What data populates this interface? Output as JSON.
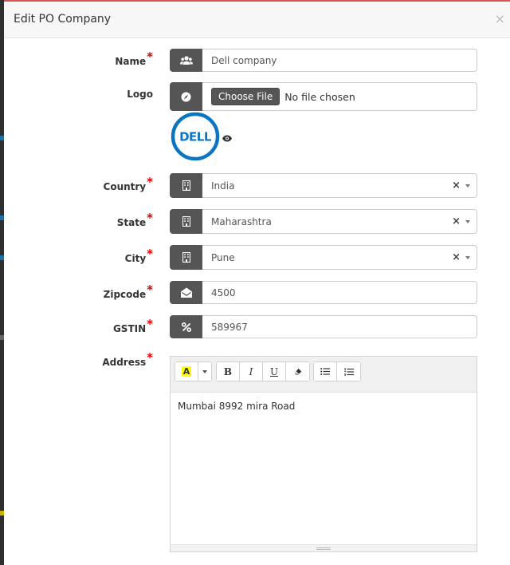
{
  "modal": {
    "title": "Edit PO Company",
    "close_label": "×"
  },
  "required_marker": "*",
  "fields": {
    "name": {
      "label": "Name",
      "value": "Dell company",
      "icon": "users-icon"
    },
    "logo": {
      "label": "Logo",
      "button_label": "Choose File",
      "status": "No file chosen",
      "icon": "compass-icon",
      "logo_text": "DELL"
    },
    "country": {
      "label": "Country",
      "value": "India",
      "icon": "building-icon"
    },
    "state": {
      "label": "State",
      "value": "Maharashtra",
      "icon": "building-icon"
    },
    "city": {
      "label": "City",
      "value": "Pune",
      "icon": "building-icon"
    },
    "zipcode": {
      "label": "Zipcode",
      "value": "4500",
      "icon": "envelope-open-icon"
    },
    "gstin": {
      "label": "GSTIN",
      "value": "589967",
      "icon": "percent-icon"
    },
    "address": {
      "label": "Address",
      "value": "Mumbai 8992 mira Road"
    }
  },
  "select_clear": "×",
  "toolbar": {
    "color_label": "A",
    "bold_label": "B",
    "italic_label": "I",
    "underline_label": "U"
  },
  "colors": {
    "addon_bg": "#555555",
    "required": "#e60000",
    "dell_blue": "#0a75c2",
    "highlight": "#ffff00"
  }
}
